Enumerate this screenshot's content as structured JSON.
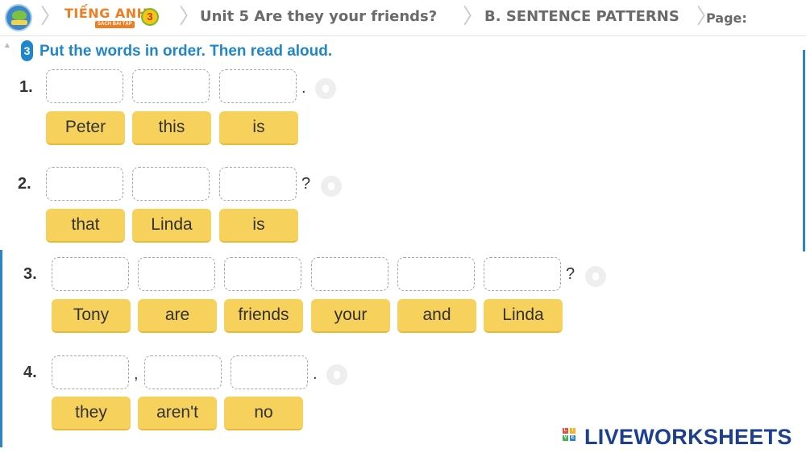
{
  "header": {
    "brand_title": "TIẾNG ANH",
    "brand_subtitle": "SÁCH BÀI TẬP",
    "brand_grade": "3",
    "breadcrumb_unit": "Unit 5 Are they your friends?",
    "breadcrumb_section": "B. SENTENCE PATTERNS",
    "breadcrumb_page": "Page:"
  },
  "exercise": {
    "number": "3",
    "instruction": "Put the words in order. Then read aloud."
  },
  "questions": [
    {
      "number": "1.",
      "punctuation": ".",
      "words": [
        "Peter",
        "this",
        "is"
      ]
    },
    {
      "number": "2.",
      "punctuation": "?",
      "words": [
        "that",
        "Linda",
        "is"
      ]
    },
    {
      "number": "3.",
      "punctuation": "?",
      "words": [
        "Tony",
        "are",
        "friends",
        "your",
        "and",
        "Linda"
      ]
    },
    {
      "number": "4.",
      "comma": ",",
      "punctuation": ".",
      "words": [
        "they",
        "aren't",
        "no"
      ]
    }
  ],
  "footer": {
    "logo_letters": [
      "L",
      "I",
      "V",
      "E"
    ],
    "logo_text": "LIVEWORKSHEETS"
  },
  "colors": {
    "accent": "#1f86c9",
    "chip": "#f6d15b",
    "brand_orange": "#ef7d22",
    "logo_navy": "#1d3f8f"
  }
}
